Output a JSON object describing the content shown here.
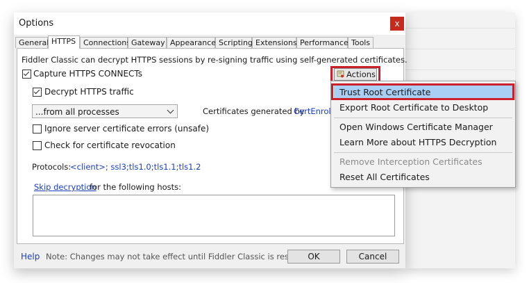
{
  "dialog": {
    "title": "Options",
    "close_glyph": "x"
  },
  "tabs": [
    {
      "label": "General"
    },
    {
      "label": "HTTPS"
    },
    {
      "label": "Connections"
    },
    {
      "label": "Gateway"
    },
    {
      "label": "Appearance"
    },
    {
      "label": "Scripting"
    },
    {
      "label": "Extensions"
    },
    {
      "label": "Performance"
    },
    {
      "label": "Tools"
    }
  ],
  "active_tab": "HTTPS",
  "https": {
    "description": "Fiddler Classic can decrypt HTTPS sessions by re-signing traffic using self-generated certificates.",
    "capture_label": "Capture HTTPS CONNECTs",
    "capture_checked": true,
    "decrypt_label": "Decrypt HTTPS traffic",
    "decrypt_checked": true,
    "process_filter_value": "...from all processes",
    "certs_generated_prefix": "Certificates generated by",
    "certs_generated_link": "CertEnroll e",
    "ignore_errors_label": "Ignore server certificate errors (unsafe)",
    "ignore_errors_checked": false,
    "revocation_label": "Check for certificate revocation",
    "revocation_checked": false,
    "protocols_prefix": "Protocols:",
    "protocols_value": "<client>; ssl3;tls1.0;tls1.1;tls1.2",
    "skip_link": "Skip decryption",
    "skip_suffix": "for the following hosts:",
    "hosts_value": "",
    "actions_label": "Actions"
  },
  "footer": {
    "help": "Help",
    "note": "Note: Changes may not take effect until Fiddler Classic is restarted.",
    "ok": "OK",
    "cancel": "Cancel"
  },
  "menu": {
    "trust_root": "Trust Root Certificate",
    "export_root": "Export Root Certificate to Desktop",
    "open_manager": "Open Windows Certificate Manager",
    "learn_more": "Learn More about HTTPS Decryption",
    "remove_interception": "Remove Interception Certificates",
    "reset_all": "Reset All Certificates"
  },
  "colors": {
    "highlight_red": "#cc1f2a",
    "menu_hover": "#a9cff5",
    "link_blue": "#1a3fbf"
  }
}
